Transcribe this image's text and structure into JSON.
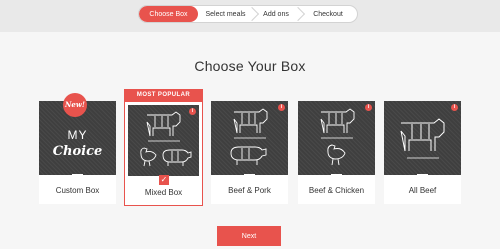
{
  "steps": [
    {
      "label": "Choose Box",
      "active": true
    },
    {
      "label": "Select meals",
      "active": false
    },
    {
      "label": "Add ons",
      "active": false
    },
    {
      "label": "Checkout",
      "active": false
    }
  ],
  "heading": "Choose Your Box",
  "boxes": [
    {
      "label": "Custom Box",
      "badge": "New!",
      "art_line1": "MY",
      "art_line2": "Choice",
      "icons": [
        "new-badge"
      ]
    },
    {
      "label": "Mixed Box",
      "ribbon": "MOST POPULAR",
      "selected": true,
      "icons": [
        "cow-icon",
        "chicken-icon",
        "pig-icon"
      ]
    },
    {
      "label": "Beef & Pork",
      "icons": [
        "cow-icon",
        "pig-icon"
      ]
    },
    {
      "label": "Beef & Chicken",
      "icons": [
        "cow-icon",
        "chicken-icon"
      ]
    },
    {
      "label": "All Beef",
      "icons": [
        "cow-icon"
      ]
    }
  ],
  "info_icon": "i",
  "check_glyph": "✓",
  "next_label": "Next",
  "colors": {
    "accent": "#e8534d",
    "tile_bg": "#3f3f3f",
    "page_bg": "#f6f6f6",
    "topbar_bg": "#e9e9e9"
  }
}
